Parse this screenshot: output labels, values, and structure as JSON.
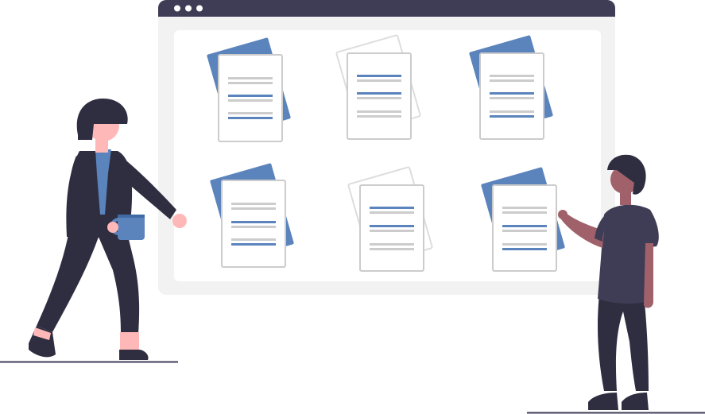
{
  "colors": {
    "window_bar": "#3f3d56",
    "window_frame": "#f2f2f2",
    "panel": "#ffffff",
    "accent_blue": "#5b84bd",
    "doc_border": "#cccccc",
    "line_gray": "#cccccc",
    "line_blue": "#5b84bd",
    "person_dark": "#2f2e41",
    "person_shirt_dark": "#3f3d56",
    "skin_light": "#ffb8b8",
    "skin_dark": "#a0616a",
    "hair_dark": "#2f2e41",
    "ground_line": "#3f3d56"
  },
  "icons": {
    "window_controls": [
      "window-dot-icon",
      "window-dot-icon",
      "window-dot-icon"
    ]
  },
  "documents": [
    {
      "name": "document-card-1",
      "back_sheet": "blue"
    },
    {
      "name": "document-card-2",
      "back_sheet": "outline"
    },
    {
      "name": "document-card-3",
      "back_sheet": "blue"
    },
    {
      "name": "document-card-4",
      "back_sheet": "blue"
    },
    {
      "name": "document-card-5",
      "back_sheet": "outline"
    },
    {
      "name": "document-card-6",
      "back_sheet": "blue"
    }
  ]
}
